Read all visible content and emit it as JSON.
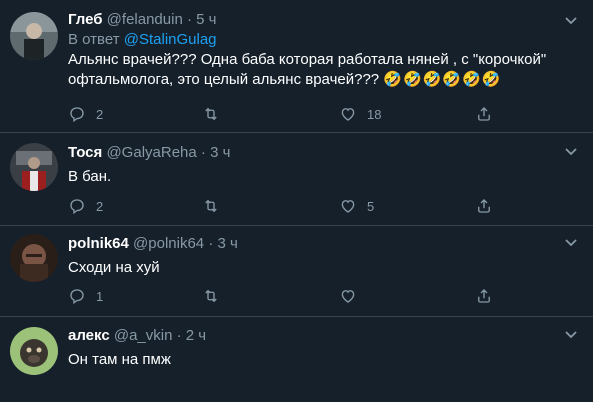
{
  "tweets": [
    {
      "name": "Глеб",
      "handle": "@felanduin",
      "dot": "·",
      "time": "5 ч",
      "reply_prefix": "В ответ",
      "reply_mention": "@StalinGulag",
      "text_line1": "Альянс врачей??? Одна баба которая работала няней , с \"корочкой\"",
      "text_line2": "офтальмолога, это целый альянс врачей???",
      "emojis": "🤣🤣🤣🤣🤣🤣",
      "replies": "2",
      "retweets": "",
      "likes": "18",
      "avatar_colors": [
        "#6a7a7f",
        "#2c3336"
      ]
    },
    {
      "name": "Тося",
      "handle": "@GalyaReha",
      "dot": "·",
      "time": "3 ч",
      "text_line1": "В бан.",
      "replies": "2",
      "retweets": "",
      "likes": "5",
      "avatar_colors": [
        "#4a4f55",
        "#a02020"
      ]
    },
    {
      "name": "polnik64",
      "handle": "@polnik64",
      "dot": "·",
      "time": "3 ч",
      "text_line1": "Сходи на хуй",
      "replies": "1",
      "retweets": "",
      "likes": "",
      "avatar_colors": [
        "#6b4a3a",
        "#2a1e18"
      ]
    },
    {
      "name": "алекс",
      "handle": "@a_vkin",
      "dot": "·",
      "time": "2 ч",
      "text_line1": "Он там на пмж",
      "avatar_colors": [
        "#8fb36a",
        "#3b3530"
      ]
    }
  ],
  "icons": {
    "reply": "reply-icon",
    "retweet": "retweet-icon",
    "like": "heart-icon",
    "share": "share-icon",
    "caret": "chevron-down-icon"
  },
  "colors": {
    "background": "#15202b",
    "secondary_text": "#8899a6",
    "link": "#1da1f2",
    "divider": "#38444d"
  }
}
